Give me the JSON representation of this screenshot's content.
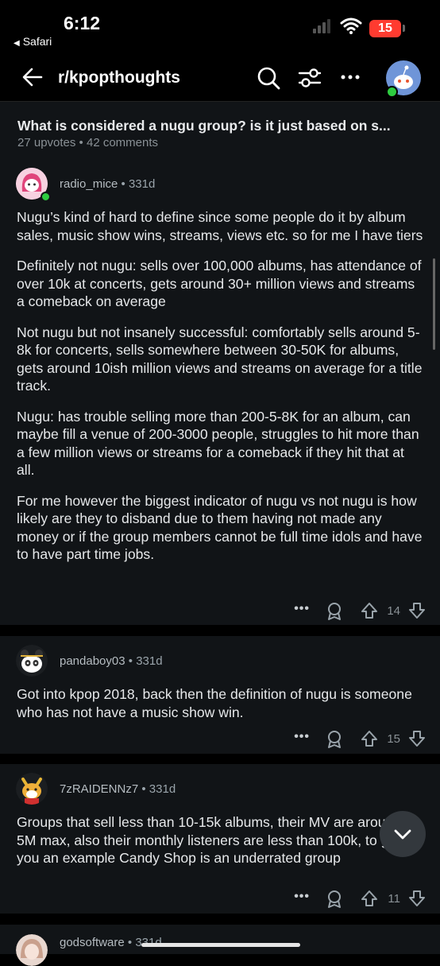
{
  "status": {
    "time": "6:12",
    "back_app": "Safari",
    "battery": "15"
  },
  "nav": {
    "subreddit": "r/kpopthoughts"
  },
  "post": {
    "title": "What is considered a nugu group? is it just based on s...",
    "meta": "27 upvotes • 42 comments"
  },
  "comments": [
    {
      "username": "radio_mice",
      "age": "331d",
      "paragraphs": [
        "Nugu’s kind of hard to define since some people do it by album sales, music show wins, streams, views etc. so for me I have tiers",
        "Definitely not nugu: sells over 100,000 albums, has attendance of over 10k at concerts, gets around 30+ million views and streams a comeback on average",
        "Not nugu but not insanely successful: comfortably sells around 5-8k for concerts, sells somewhere between 30-50K for albums, gets around 10ish million views and streams on average for a title track.",
        "Nugu: has trouble selling more than 200-5-8K for an album, can maybe fill a venue of 200-3000 people, struggles to hit more than a few million views or streams for a comeback if they hit that at all.",
        "For me however the biggest indicator of nugu vs not nugu is how likely are they to disband due to them having not made any money or if the group members cannot be full time idols and have to have part time jobs."
      ],
      "dots": "•••",
      "votes": "14"
    },
    {
      "username": "pandaboy03",
      "age": "331d",
      "paragraphs": [
        "Got into kpop 2018, back then the definition of nugu is someone who has not have a music show win."
      ],
      "dots": "•••",
      "votes": "15"
    },
    {
      "username": "7zRAIDENNz7",
      "age": "331d",
      "paragraphs": [
        "Groups that sell less than 10-15k albums, their MV are around 1-5M max, also their monthly listeners are less than 100k, to give you an example Candy Shop is an underrated group"
      ],
      "dots": "•••",
      "votes": "11"
    },
    {
      "username": "godsoftware",
      "age": "331d"
    }
  ],
  "colors": {
    "background": "#000000",
    "card": "#111417",
    "online": "#2ecc40",
    "battery": "#ff3b30"
  }
}
